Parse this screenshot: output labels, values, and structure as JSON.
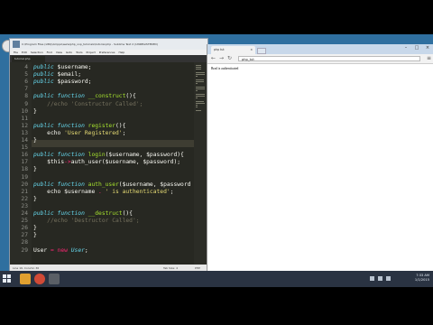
{
  "editor": {
    "window_title": "C:\\Program Files (x86)\\Ampps\\www\\php_oop_tutorials\\tutorial.php - Sublime Text 2 (UNREGISTERED)",
    "menu": [
      "File",
      "Edit",
      "Selection",
      "Find",
      "View",
      "Goto",
      "Tools",
      "Project",
      "Preferences",
      "Help"
    ],
    "tab_label": "tutorial.php",
    "lines": [
      {
        "n": "4",
        "segs": [
          {
            "t": "public",
            "c": "sk"
          },
          {
            "t": " $username;",
            "c": ""
          }
        ]
      },
      {
        "n": "5",
        "segs": [
          {
            "t": "public",
            "c": "sk"
          },
          {
            "t": " $email;",
            "c": ""
          }
        ]
      },
      {
        "n": "6",
        "segs": [
          {
            "t": "public",
            "c": "sk"
          },
          {
            "t": " $password;",
            "c": ""
          }
        ]
      },
      {
        "n": "7",
        "segs": []
      },
      {
        "n": "8",
        "segs": [
          {
            "t": "public function ",
            "c": "sk"
          },
          {
            "t": "__construct",
            "c": "fn"
          },
          {
            "t": "(){",
            "c": ""
          }
        ]
      },
      {
        "n": "9",
        "segs": [
          {
            "t": "    //echo 'Constructor Called';",
            "c": "cm"
          }
        ]
      },
      {
        "n": "10",
        "segs": [
          {
            "t": "}",
            "c": ""
          }
        ]
      },
      {
        "n": "11",
        "segs": []
      },
      {
        "n": "12",
        "segs": [
          {
            "t": "public function ",
            "c": "sk"
          },
          {
            "t": "register",
            "c": "fn"
          },
          {
            "t": "(){",
            "c": ""
          }
        ]
      },
      {
        "n": "13",
        "segs": [
          {
            "t": "    echo ",
            "c": ""
          },
          {
            "t": "'User Registered'",
            "c": "st"
          },
          {
            "t": ";",
            "c": ""
          }
        ]
      },
      {
        "n": "14",
        "segs": [
          {
            "t": "}",
            "c": ""
          }
        ]
      },
      {
        "n": "15",
        "segs": []
      },
      {
        "n": "16",
        "segs": [
          {
            "t": "public function ",
            "c": "sk"
          },
          {
            "t": "login",
            "c": "fn"
          },
          {
            "t": "($username, $password){",
            "c": ""
          }
        ]
      },
      {
        "n": "17",
        "segs": [
          {
            "t": "    $this",
            "c": ""
          },
          {
            "t": "->",
            "c": "kw"
          },
          {
            "t": "auth_user($username, $password);",
            "c": ""
          }
        ]
      },
      {
        "n": "18",
        "segs": [
          {
            "t": "}",
            "c": ""
          }
        ]
      },
      {
        "n": "19",
        "segs": []
      },
      {
        "n": "20",
        "segs": [
          {
            "t": "public function ",
            "c": "sk"
          },
          {
            "t": "auth_user",
            "c": "fn"
          },
          {
            "t": "($username, $password",
            "c": ""
          }
        ]
      },
      {
        "n": "21",
        "segs": [
          {
            "t": "    echo ",
            "c": ""
          },
          {
            "t": "$username ",
            "c": ""
          },
          {
            "t": ".",
            "c": "kw"
          },
          {
            "t": " ' is authenticated'",
            "c": "st"
          },
          {
            "t": ";",
            "c": ""
          }
        ]
      },
      {
        "n": "22",
        "segs": [
          {
            "t": "}",
            "c": ""
          }
        ]
      },
      {
        "n": "23",
        "segs": []
      },
      {
        "n": "24",
        "segs": [
          {
            "t": "public function ",
            "c": "sk"
          },
          {
            "t": "__destruct",
            "c": "fn"
          },
          {
            "t": "(){",
            "c": ""
          }
        ]
      },
      {
        "n": "25",
        "segs": [
          {
            "t": "    //echo 'Destructor Called';",
            "c": "cm"
          }
        ]
      },
      {
        "n": "26",
        "segs": [
          {
            "t": "}",
            "c": ""
          }
        ]
      },
      {
        "n": "27",
        "segs": [
          {
            "t": "}",
            "c": ""
          }
        ]
      },
      {
        "n": "28",
        "segs": []
      },
      {
        "n": "29",
        "segs": [
          {
            "t": "User ",
            "c": ""
          },
          {
            "t": "=",
            "c": "kw"
          },
          {
            "t": " ",
            "c": ""
          },
          {
            "t": "new ",
            "c": "kw"
          },
          {
            "t": "User",
            "c": "sk"
          },
          {
            "t": ";",
            "c": ""
          }
        ]
      }
    ],
    "status_left": "Line 16, Column 36",
    "status_mid": "Tab Size: 4",
    "status_right": "PHP"
  },
  "browser": {
    "tab_title": "php tut",
    "tab_close": "×",
    "url": "php_tut",
    "page_text": "Brad is authenticated",
    "win_min": "–",
    "win_max": "□",
    "win_close": "×"
  },
  "taskbar": {
    "time": "7:33 AM",
    "date": "1/1/2015"
  },
  "colors": {
    "editor_bg": "#272822",
    "keyword": "#f92672",
    "storage": "#66d9ef",
    "function": "#a6e22e",
    "string": "#e6db74",
    "comment": "#75715e",
    "desktop": "#2f6f9f",
    "taskbar": "#2a3342"
  }
}
